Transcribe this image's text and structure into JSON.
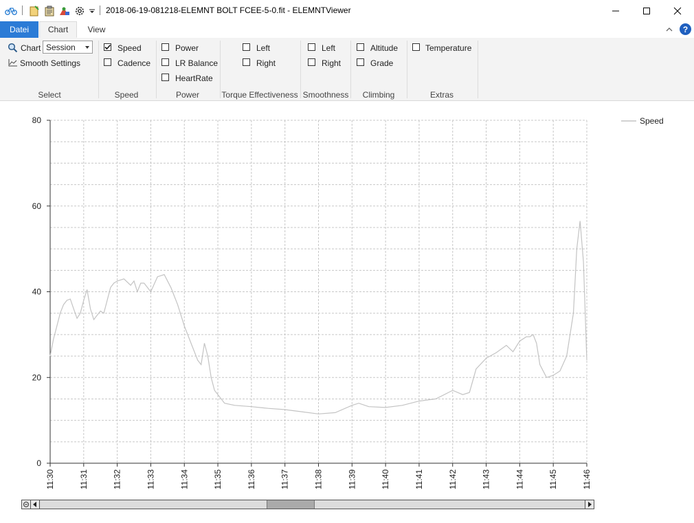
{
  "window": {
    "title": "2018-06-19-081218-ELEMNT BOLT FCEE-5-0.fit - ELEMNTViewer"
  },
  "quick_access": {
    "icons": [
      "bike-logo-icon",
      "open-file-icon",
      "clipboard-icon",
      "map-people-icon",
      "settings-gear-icon",
      "dropdown-arrow-icon"
    ]
  },
  "tabs": [
    {
      "label": "Datei"
    },
    {
      "label": "Chart"
    },
    {
      "label": "View"
    }
  ],
  "ribbon": {
    "select": {
      "chart_label": "Chart",
      "combo_value": "Session",
      "smooth_label": "Smooth Settings",
      "group_label": "Select"
    },
    "speed": {
      "speed_label": "Speed",
      "speed_checked": true,
      "cadence_label": "Cadence",
      "cadence_checked": false,
      "group_label": "Speed"
    },
    "power": {
      "power_label": "Power",
      "lr_label": "LR Balance",
      "hr_label": "HeartRate",
      "group_label": "Power"
    },
    "torque": {
      "left_label": "Left",
      "right_label": "Right",
      "group_label": "Torque Effectiveness"
    },
    "smoothness": {
      "left_label": "Left",
      "right_label": "Right",
      "group_label": "Smoothness"
    },
    "climbing": {
      "altitude_label": "Altitude",
      "grade_label": "Grade",
      "group_label": "Climbing"
    },
    "extras": {
      "temperature_label": "Temperature",
      "group_label": "Extras"
    }
  },
  "chart_data": {
    "type": "line",
    "title": "",
    "xlabel": "",
    "ylabel": "",
    "ylim": [
      0,
      80
    ],
    "yticks": [
      "0",
      "20",
      "40",
      "60",
      "80"
    ],
    "xticks": [
      "11:30",
      "11:31",
      "11:32",
      "11:33",
      "11:34",
      "11:35",
      "11:36",
      "11:37",
      "11:38",
      "11:39",
      "11:40",
      "11:41",
      "11:42",
      "11:43",
      "11:44",
      "11:45",
      "11:46"
    ],
    "grid": true,
    "legend_position": "top-right",
    "series": [
      {
        "name": "Speed",
        "color": "#c3c3c3",
        "x_minutes": [
          0,
          0.1,
          0.2,
          0.3,
          0.4,
          0.5,
          0.6,
          0.7,
          0.8,
          0.9,
          1.0,
          1.1,
          1.2,
          1.3,
          1.4,
          1.5,
          1.6,
          1.7,
          1.8,
          1.9,
          2.0,
          2.2,
          2.4,
          2.5,
          2.6,
          2.7,
          2.8,
          3.0,
          3.2,
          3.4,
          3.6,
          3.8,
          4.0,
          4.2,
          4.4,
          4.5,
          4.6,
          4.7,
          4.8,
          4.9,
          5.0,
          5.2,
          5.5,
          6.0,
          6.5,
          7.0,
          7.5,
          8.0,
          8.5,
          9.0,
          9.2,
          9.5,
          10.0,
          10.5,
          11.0,
          11.5,
          12.0,
          12.3,
          12.5,
          12.7,
          13.0,
          13.3,
          13.6,
          13.8,
          14.0,
          14.2,
          14.3,
          14.4,
          14.5,
          14.6,
          14.8,
          15.0,
          15.2,
          15.4,
          15.6,
          15.7,
          15.8,
          15.9,
          16.0
        ],
        "y": [
          25,
          29,
          32,
          35,
          37,
          38,
          38.3,
          36,
          33.8,
          35,
          38,
          40.5,
          36,
          33.5,
          34.5,
          35.5,
          35,
          38,
          41,
          42,
          42.5,
          43,
          41.5,
          42.5,
          40,
          42,
          42,
          40,
          43.5,
          44,
          41,
          37,
          32,
          28,
          24,
          23,
          28,
          25,
          20,
          17,
          16,
          14,
          13.5,
          13.2,
          12.8,
          12.5,
          12.0,
          11.5,
          11.8,
          13.5,
          14,
          13.2,
          13,
          13.5,
          14.5,
          15,
          17,
          16,
          16.5,
          22,
          24.5,
          25.8,
          27.5,
          26,
          28.5,
          29.5,
          29.5,
          30,
          28,
          23,
          20,
          20.5,
          21.5,
          25,
          35,
          50,
          56.5,
          47,
          24
        ]
      }
    ]
  }
}
